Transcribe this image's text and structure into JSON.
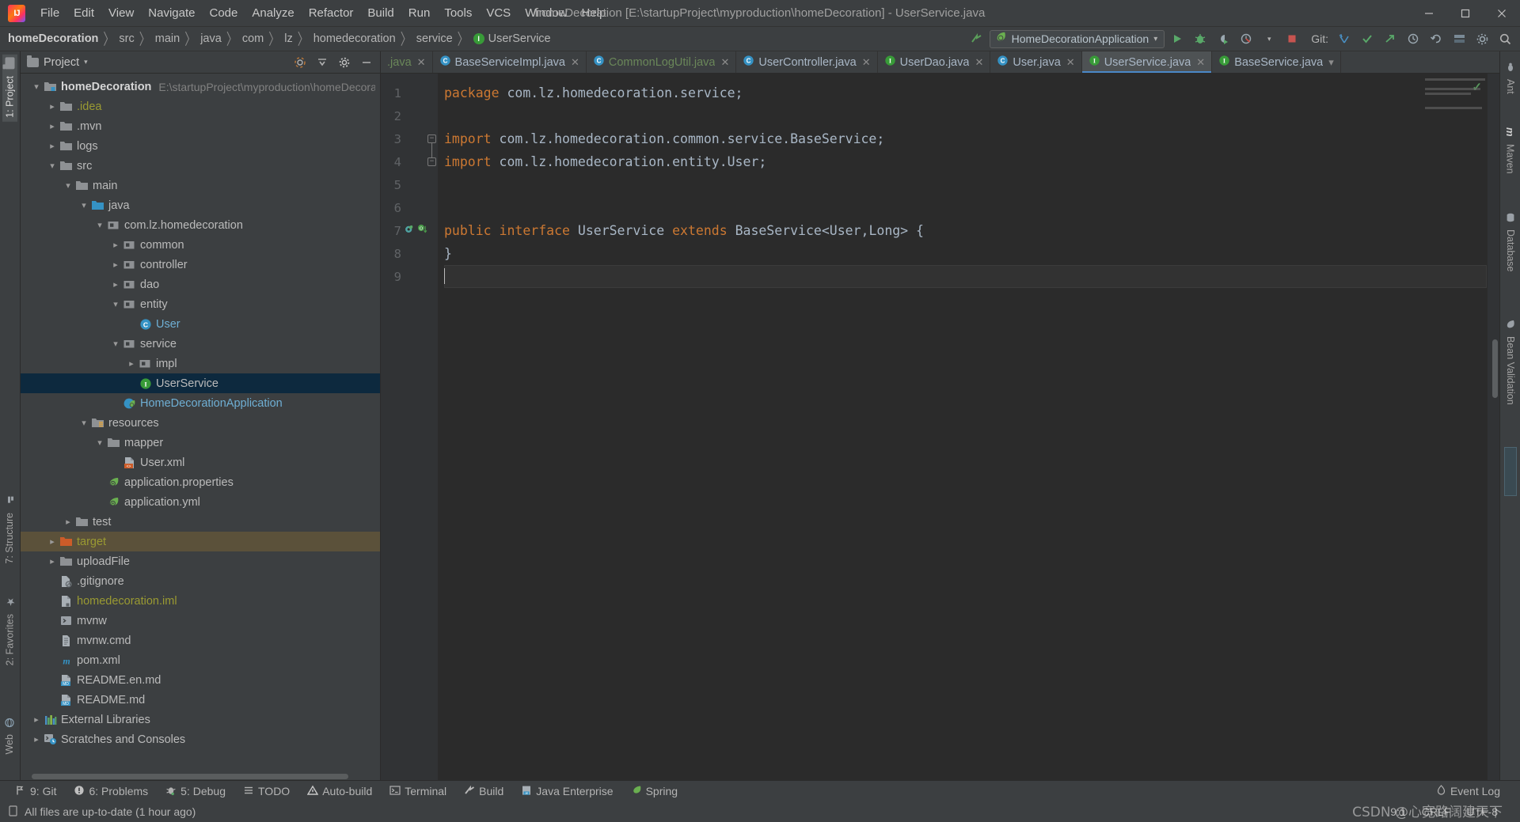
{
  "window": {
    "title": "homeDecoration [E:\\startupProject\\myproduction\\homeDecoration] - UserService.java",
    "minimize": "–",
    "maximize": "▫",
    "close": "✕"
  },
  "menu": {
    "items": [
      {
        "label": "File"
      },
      {
        "label": "Edit"
      },
      {
        "label": "View"
      },
      {
        "label": "Navigate"
      },
      {
        "label": "Code"
      },
      {
        "label": "Analyze"
      },
      {
        "label": "Refactor"
      },
      {
        "label": "Build"
      },
      {
        "label": "Run"
      },
      {
        "label": "Tools"
      },
      {
        "label": "VCS"
      },
      {
        "label": "Window"
      },
      {
        "label": "Help"
      }
    ]
  },
  "navbar": {
    "crumbs": [
      "homeDecoration",
      "src",
      "main",
      "java",
      "com",
      "lz",
      "homedecoration",
      "service",
      "UserService"
    ],
    "separator": "〉",
    "run_config": "HomeDecorationApplication",
    "run_config_caret": "▾",
    "git_label": "Git:",
    "actions": [
      "run-icon",
      "debug-icon",
      "run-coverage-icon",
      "profile-icon",
      "stop-icon"
    ],
    "git_actions": [
      "update-project-icon",
      "commit-icon",
      "push-icon",
      "history-icon",
      "rollback-icon"
    ],
    "right_actions": [
      "build-icon",
      "settings-icon",
      "search-icon"
    ]
  },
  "left_strip": {
    "tabs": [
      {
        "label": "1: Project",
        "active": true
      },
      {
        "label": "7: Structure",
        "active": false
      },
      {
        "label": "2: Favorites",
        "active": false
      },
      {
        "label": "Web",
        "active": false
      }
    ]
  },
  "right_strip": {
    "tabs": [
      {
        "label": "Ant",
        "icon": "ant-icon"
      },
      {
        "label": "Maven",
        "icon": "maven-icon"
      },
      {
        "label": "Database",
        "icon": "database-icon"
      },
      {
        "label": "Bean Validation",
        "icon": "bean-icon"
      }
    ]
  },
  "project_panel": {
    "title": "Project",
    "title_caret": "▾",
    "actions": [
      "locate-icon",
      "collapse-all-icon",
      "settings-icon",
      "hide-icon"
    ],
    "tree": [
      {
        "label": "homeDecoration",
        "sub": "E:\\startupProject\\myproduction\\homeDecora",
        "indent": 0,
        "arrow": "down",
        "icon": "module-folder",
        "style": "bold"
      },
      {
        "label": ".idea",
        "indent": 1,
        "arrow": "right",
        "icon": "folder",
        "style": "olive"
      },
      {
        "label": ".mvn",
        "indent": 1,
        "arrow": "right",
        "icon": "folder",
        "style": ""
      },
      {
        "label": "logs",
        "indent": 1,
        "arrow": "right",
        "icon": "folder",
        "style": ""
      },
      {
        "label": "src",
        "indent": 1,
        "arrow": "down",
        "icon": "folder",
        "style": ""
      },
      {
        "label": "main",
        "indent": 2,
        "arrow": "down",
        "icon": "folder",
        "style": ""
      },
      {
        "label": "java",
        "indent": 3,
        "arrow": "down",
        "icon": "folder-blue",
        "style": ""
      },
      {
        "label": "com.lz.homedecoration",
        "indent": 4,
        "arrow": "down",
        "icon": "package",
        "style": ""
      },
      {
        "label": "common",
        "indent": 5,
        "arrow": "right",
        "icon": "package",
        "style": ""
      },
      {
        "label": "controller",
        "indent": 5,
        "arrow": "right",
        "icon": "package",
        "style": ""
      },
      {
        "label": "dao",
        "indent": 5,
        "arrow": "right",
        "icon": "package",
        "style": ""
      },
      {
        "label": "entity",
        "indent": 5,
        "arrow": "down",
        "icon": "package",
        "style": ""
      },
      {
        "label": "User",
        "indent": 6,
        "arrow": "none",
        "icon": "class",
        "style": "blue"
      },
      {
        "label": "service",
        "indent": 5,
        "arrow": "down",
        "icon": "package",
        "style": ""
      },
      {
        "label": "impl",
        "indent": 6,
        "arrow": "right",
        "icon": "package",
        "style": ""
      },
      {
        "label": "UserService",
        "indent": 6,
        "arrow": "none",
        "icon": "interface",
        "style": "",
        "selected": true
      },
      {
        "label": "HomeDecorationApplication",
        "indent": 5,
        "arrow": "none",
        "icon": "spring-class",
        "style": "blue"
      },
      {
        "label": "resources",
        "indent": 3,
        "arrow": "down",
        "icon": "resources-folder",
        "style": ""
      },
      {
        "label": "mapper",
        "indent": 4,
        "arrow": "down",
        "icon": "folder",
        "style": ""
      },
      {
        "label": "User.xml",
        "indent": 5,
        "arrow": "none",
        "icon": "xml-file",
        "style": ""
      },
      {
        "label": "application.properties",
        "indent": 4,
        "arrow": "none",
        "icon": "spring-file",
        "style": ""
      },
      {
        "label": "application.yml",
        "indent": 4,
        "arrow": "none",
        "icon": "spring-file",
        "style": ""
      },
      {
        "label": "test",
        "indent": 2,
        "arrow": "right",
        "icon": "folder",
        "style": ""
      },
      {
        "label": "target",
        "indent": 1,
        "arrow": "right",
        "icon": "folder-orange",
        "style": "olive",
        "excluded": true
      },
      {
        "label": "uploadFile",
        "indent": 1,
        "arrow": "right",
        "icon": "folder",
        "style": ""
      },
      {
        "label": ".gitignore",
        "indent": 1,
        "arrow": "none",
        "icon": "gitignore-file",
        "style": ""
      },
      {
        "label": "homedecoration.iml",
        "indent": 1,
        "arrow": "none",
        "icon": "iml-file",
        "style": "olive"
      },
      {
        "label": "mvnw",
        "indent": 1,
        "arrow": "none",
        "icon": "shell-file",
        "style": ""
      },
      {
        "label": "mvnw.cmd",
        "indent": 1,
        "arrow": "none",
        "icon": "cmd-file",
        "style": ""
      },
      {
        "label": "pom.xml",
        "indent": 1,
        "arrow": "none",
        "icon": "maven-file",
        "style": ""
      },
      {
        "label": "README.en.md",
        "indent": 1,
        "arrow": "none",
        "icon": "md-file",
        "style": ""
      },
      {
        "label": "README.md",
        "indent": 1,
        "arrow": "none",
        "icon": "md-file",
        "style": ""
      },
      {
        "label": "External Libraries",
        "indent": 0,
        "arrow": "right",
        "icon": "libraries-icon",
        "style": ""
      },
      {
        "label": "Scratches and Consoles",
        "indent": 0,
        "arrow": "right",
        "icon": "scratches-icon",
        "style": ""
      }
    ]
  },
  "editor_tabs": [
    {
      "label": ".java",
      "icon": "java-file",
      "color": "green",
      "active": false,
      "closable": true
    },
    {
      "label": "BaseServiceImpl.java",
      "icon": "class",
      "color": "default",
      "active": false,
      "closable": true
    },
    {
      "label": "CommonLogUtil.java",
      "icon": "class",
      "color": "green",
      "active": false,
      "closable": true
    },
    {
      "label": "UserController.java",
      "icon": "class",
      "color": "default",
      "active": false,
      "closable": true
    },
    {
      "label": "UserDao.java",
      "icon": "interface",
      "color": "default",
      "active": false,
      "closable": true
    },
    {
      "label": "User.java",
      "icon": "class",
      "color": "default",
      "active": false,
      "closable": true
    },
    {
      "label": "UserService.java",
      "icon": "interface",
      "color": "default",
      "active": true,
      "closable": true
    },
    {
      "label": "BaseService.java",
      "icon": "interface",
      "color": "default",
      "active": false,
      "closable": false
    }
  ],
  "editor": {
    "filename": "UserService.java",
    "lines": [
      {
        "n": 1,
        "segments": [
          {
            "t": "package",
            "c": "kw"
          },
          {
            "t": " com.lz.homedecoration.service;",
            "c": "plain"
          }
        ]
      },
      {
        "n": 2,
        "segments": [
          {
            "t": "",
            "c": "plain"
          }
        ]
      },
      {
        "n": 3,
        "segments": [
          {
            "t": "import",
            "c": "kw"
          },
          {
            "t": " com.lz.homedecoration.common.service.BaseService;",
            "c": "plain"
          }
        ],
        "fold": "start"
      },
      {
        "n": 4,
        "segments": [
          {
            "t": "import",
            "c": "kw"
          },
          {
            "t": " com.lz.homedecoration.entity.User;",
            "c": "plain"
          }
        ],
        "fold": "end"
      },
      {
        "n": 5,
        "segments": [
          {
            "t": "",
            "c": "plain"
          }
        ]
      },
      {
        "n": 6,
        "segments": [
          {
            "t": "",
            "c": "plain"
          }
        ]
      },
      {
        "n": 7,
        "segments": [
          {
            "t": "public",
            "c": "kw"
          },
          {
            "t": " ",
            "c": "plain"
          },
          {
            "t": "interface",
            "c": "kw"
          },
          {
            "t": " UserService ",
            "c": "plain"
          },
          {
            "t": "extends",
            "c": "kw"
          },
          {
            "t": " BaseService<User,Long> {",
            "c": "plain"
          }
        ],
        "gutter_marks": [
          "implemented-icon",
          "override-icon"
        ]
      },
      {
        "n": 8,
        "segments": [
          {
            "t": "}",
            "c": "plain"
          }
        ]
      },
      {
        "n": 9,
        "segments": [
          {
            "t": "",
            "c": "plain"
          }
        ],
        "caret": true
      }
    ],
    "inspection_status": "✓"
  },
  "tool_windows": [
    {
      "label": "9: Git",
      "icon": "git-icon",
      "mnemonic": "9"
    },
    {
      "label": "6: Problems",
      "icon": "problems-icon",
      "mnemonic": "6"
    },
    {
      "label": "5: Debug",
      "icon": "debug-icon",
      "mnemonic": "5"
    },
    {
      "label": "TODO",
      "icon": "todo-icon",
      "mnemonic": ""
    },
    {
      "label": "Auto-build",
      "icon": "autobuild-icon",
      "mnemonic": ""
    },
    {
      "label": "Terminal",
      "icon": "terminal-icon",
      "mnemonic": ""
    },
    {
      "label": "Build",
      "icon": "build-icon",
      "mnemonic": ""
    },
    {
      "label": "Java Enterprise",
      "icon": "java-enterprise-icon",
      "mnemonic": ""
    },
    {
      "label": "Spring",
      "icon": "spring-icon",
      "mnemonic": ""
    }
  ],
  "event_log": {
    "label": "Event Log",
    "icon": "event-log-icon"
  },
  "statusbar": {
    "message": "All files are up-to-date (1 hour ago)",
    "message_icon": "vcs-icon",
    "caret_position": "9:1",
    "line_separator": "CRLF",
    "encoding": "UTF-8"
  },
  "watermark": "CSDN @心宽路阔建天下",
  "colors": {
    "bg": "#3c3f41",
    "editor_bg": "#2b2b2b",
    "selection": "#0d293e",
    "accent": "#4a88c7",
    "keyword": "#cc7832",
    "text": "#a9b7c6",
    "green": "#6a8759",
    "excluded": "#5b513a"
  }
}
